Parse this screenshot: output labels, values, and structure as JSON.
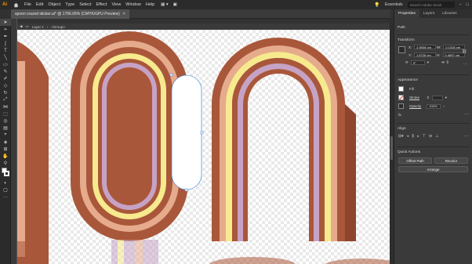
{
  "menubar": {
    "logo": "Ai",
    "items": [
      "File",
      "Edit",
      "Object",
      "Type",
      "Select",
      "Effect",
      "View",
      "Window",
      "Help"
    ],
    "workspace": "Essentials",
    "search_placeholder": "Search Adobe Stock"
  },
  "document_tab": {
    "title": "spoon crazed sticker.ai* @ 1766.06% (CMYK/GPU Preview)",
    "close": "×"
  },
  "breadcrumb": {
    "layer": "Layer 1",
    "group": "<Group>"
  },
  "panel": {
    "tabs": [
      "Properties",
      "Layers",
      "Libraries"
    ],
    "path_label": "Path",
    "transform": {
      "title": "Transform",
      "x_label": "X:",
      "x_value": "2.5938 cm",
      "y_label": "Y:",
      "y_value": "1.6726 cm",
      "w_label": "W:",
      "w_value": "0.1318 cm",
      "h_label": "H:",
      "h_value": "0.4697 cm",
      "angle_value": "0°"
    },
    "appearance": {
      "title": "Appearance",
      "fill_label": "Fill",
      "stroke_label": "Stroke",
      "opacity_label": "Opacity",
      "opacity_value": "100%"
    },
    "align_title": "Align",
    "quick_actions": {
      "title": "Quick Actions",
      "offset_path": "Offset Path",
      "recolor": "Recolor",
      "arrange": "Arrange"
    }
  },
  "colors": {
    "brown": "#a9573a",
    "peach": "#e6ab8d",
    "yellow": "#f7ea8e",
    "lavender": "#c6a3c6",
    "white": "#ffffff",
    "accent": "#2e7ad8"
  }
}
